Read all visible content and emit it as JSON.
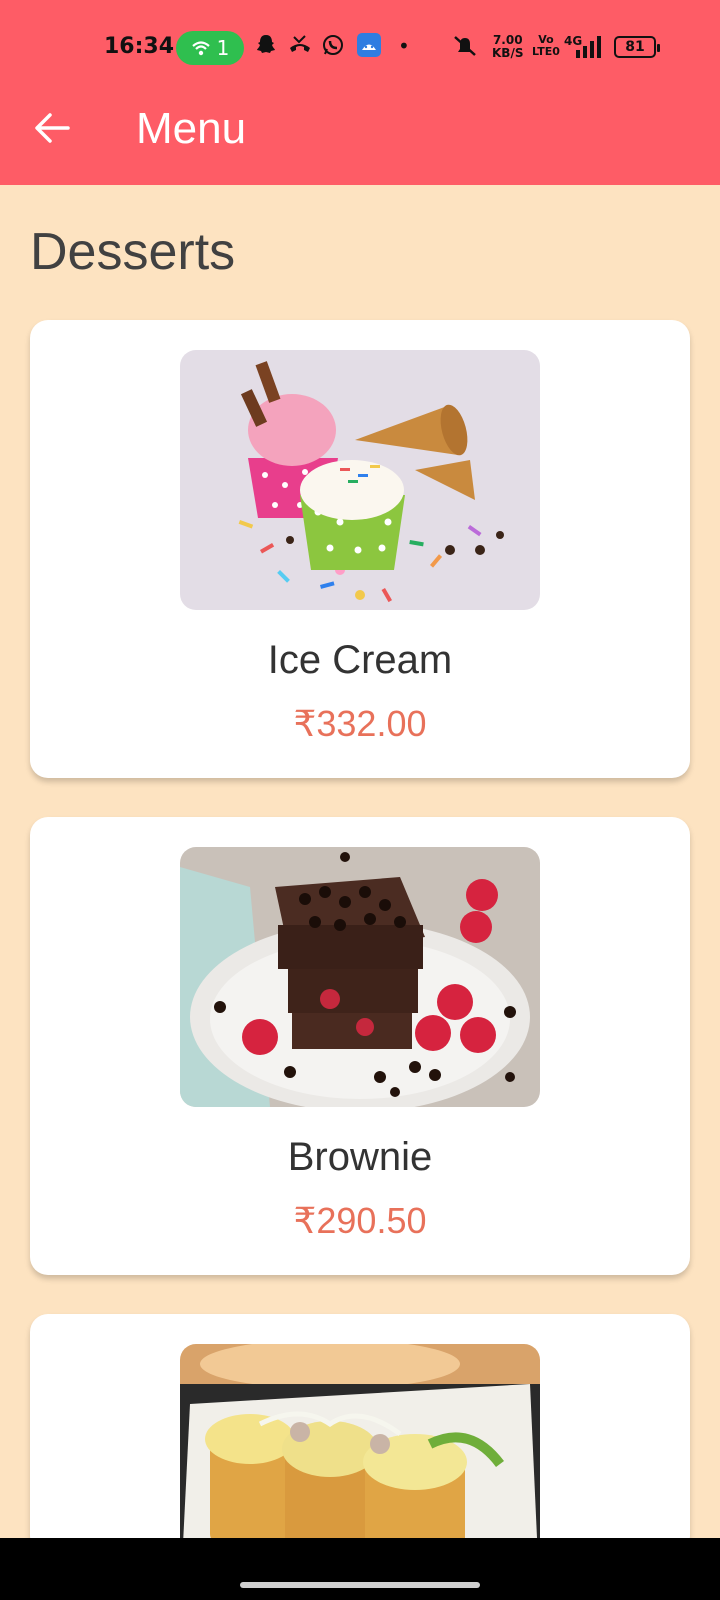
{
  "status_bar": {
    "time": "16:34",
    "hotspot_count": "1",
    "speed_value": "7.00",
    "speed_unit": "KB/S",
    "volte_top": "Vo",
    "volte_bottom": "LTE0",
    "network": "4G",
    "battery": "81",
    "icons": [
      "hotspot-icon",
      "snapchat-icon",
      "missed-call-icon",
      "whatsapp-icon",
      "android-app-icon",
      "dot-icon",
      "mute-icon",
      "signal-icon",
      "battery-icon"
    ]
  },
  "header": {
    "title": "Menu",
    "background": "#fe5c66"
  },
  "section": {
    "title": "Desserts"
  },
  "items": [
    {
      "name": "Ice Cream",
      "price": "₹332.00"
    },
    {
      "name": "Brownie",
      "price": "₹290.50"
    },
    {
      "name": "",
      "price": ""
    }
  ],
  "colors": {
    "page_background": "#fde3c1",
    "price": "#e8715a",
    "accent": "#fe5c66"
  }
}
